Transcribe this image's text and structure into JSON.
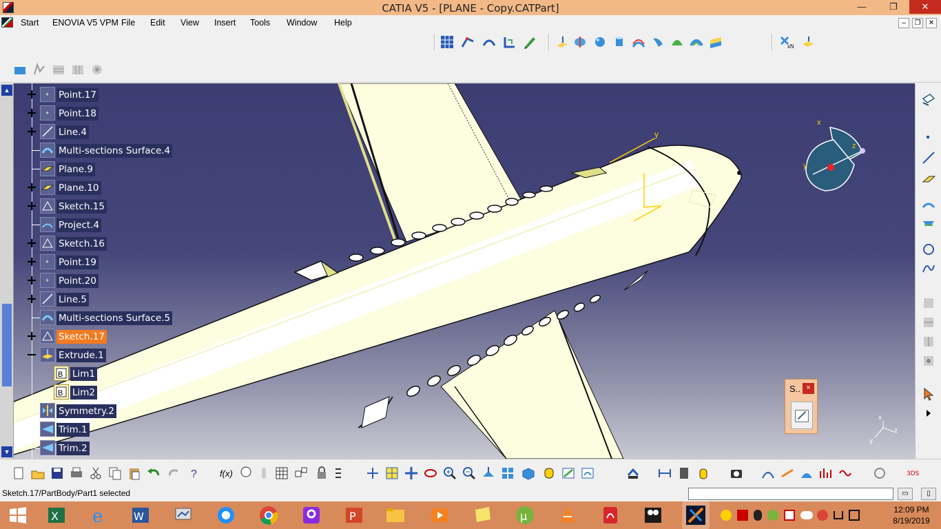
{
  "window": {
    "title": "CATIA V5 - [PLANE - Copy.CATPart]",
    "min_label": "—",
    "restore_label": "❐",
    "close_label": "✕"
  },
  "menu": {
    "start": "Start",
    "items": [
      "ENOVIA V5 VPM",
      "File",
      "Edit",
      "View",
      "Insert",
      "Tools",
      "Window",
      "Help"
    ]
  },
  "tree": {
    "items": [
      {
        "label": "Point.17",
        "icon": "point-icon",
        "expander": "plus"
      },
      {
        "label": "Point.18",
        "icon": "point-icon",
        "expander": "plus"
      },
      {
        "label": "Line.4",
        "icon": "line-icon",
        "expander": "plus"
      },
      {
        "label": "Multi-sections Surface.4",
        "icon": "multi-sections-surface-icon",
        "expander": "none"
      },
      {
        "label": "Plane.9",
        "icon": "plane-icon",
        "expander": "none"
      },
      {
        "label": "Plane.10",
        "icon": "plane-icon",
        "expander": "plus"
      },
      {
        "label": "Sketch.15",
        "icon": "sketch-icon",
        "expander": "plus"
      },
      {
        "label": "Project.4",
        "icon": "project-icon",
        "expander": "none"
      },
      {
        "label": "Sketch.16",
        "icon": "sketch-icon",
        "expander": "plus"
      },
      {
        "label": "Point.19",
        "icon": "point-icon",
        "expander": "plus"
      },
      {
        "label": "Point.20",
        "icon": "point-icon",
        "expander": "plus"
      },
      {
        "label": "Line.5",
        "icon": "line-icon",
        "expander": "plus"
      },
      {
        "label": "Multi-sections Surface.5",
        "icon": "multi-sections-surface-icon",
        "expander": "none"
      },
      {
        "label": "Sketch.17",
        "icon": "sketch-icon",
        "expander": "plus",
        "selected": true
      },
      {
        "label": "Extrude.1",
        "icon": "extrude-icon",
        "expander": "minus"
      },
      {
        "label": "Lim1",
        "icon": "limit-icon",
        "expander": "none",
        "child": true
      },
      {
        "label": "Lim2",
        "icon": "limit-icon",
        "expander": "none",
        "child": true
      },
      {
        "label": "Symmetry.2",
        "icon": "symmetry-icon",
        "expander": "none"
      },
      {
        "label": "Trim.1",
        "icon": "trim-icon",
        "expander": "none"
      },
      {
        "label": "Trim.2",
        "icon": "trim-icon",
        "expander": "none"
      }
    ]
  },
  "compass": {
    "x": "x",
    "y": "y",
    "z": "z"
  },
  "axis_labels": {
    "x": "x",
    "y": "y",
    "z": "z"
  },
  "float_toolbar": {
    "title": "S..",
    "close": "×"
  },
  "status": {
    "text": "Sketch.17/PartBody/Part1 selected",
    "command_value": ""
  },
  "taskbar": {
    "time": "12:09 PM",
    "date": "8/19/2019"
  },
  "colors": {
    "titlebar": "#f2b987",
    "tree_label_bg": "#29305d",
    "selected_label_bg": "#f27a1f",
    "viewport_top": "#3c3d72",
    "taskbar": "#d88a5b",
    "model_fill": "#fdfde0"
  }
}
